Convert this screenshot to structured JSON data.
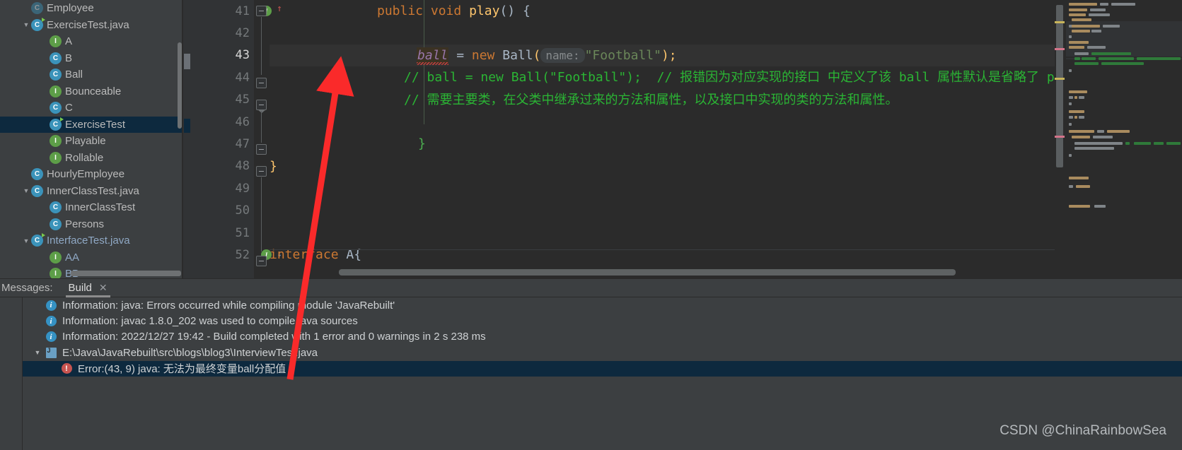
{
  "project_tree": {
    "items": [
      {
        "label": "Employee",
        "icon": "class-icon-faded",
        "indent": 1,
        "arrow": "",
        "kind": "class-faded",
        "selected": false
      },
      {
        "label": "ExerciseTest.java",
        "icon": "class-icon",
        "indent": 1,
        "arrow": "▼",
        "kind": "class-run",
        "selected": false
      },
      {
        "label": "A",
        "icon": "interface-icon",
        "indent": 2,
        "arrow": "",
        "kind": "iface",
        "selected": false
      },
      {
        "label": "B",
        "icon": "class-icon",
        "indent": 2,
        "arrow": "",
        "kind": "class",
        "selected": false
      },
      {
        "label": "Ball",
        "icon": "class-icon",
        "indent": 2,
        "arrow": "",
        "kind": "class",
        "selected": false
      },
      {
        "label": "Bounceable",
        "icon": "interface-icon",
        "indent": 2,
        "arrow": "",
        "kind": "iface",
        "selected": false
      },
      {
        "label": "C",
        "icon": "class-icon",
        "indent": 2,
        "arrow": "",
        "kind": "class",
        "selected": false
      },
      {
        "label": "ExerciseTest",
        "icon": "class-icon",
        "indent": 2,
        "arrow": "",
        "kind": "class-run",
        "selected": true
      },
      {
        "label": "Playable",
        "icon": "interface-icon",
        "indent": 2,
        "arrow": "",
        "kind": "iface",
        "selected": false
      },
      {
        "label": "Rollable",
        "icon": "interface-icon",
        "indent": 2,
        "arrow": "",
        "kind": "iface",
        "selected": false
      },
      {
        "label": "HourlyEmployee",
        "icon": "class-icon",
        "indent": 1,
        "arrow": "",
        "kind": "class",
        "selected": false
      },
      {
        "label": "InnerClassTest.java",
        "icon": "class-icon",
        "indent": 1,
        "arrow": "▼",
        "kind": "class",
        "selected": false
      },
      {
        "label": "InnerClassTest",
        "icon": "class-icon",
        "indent": 2,
        "arrow": "",
        "kind": "class",
        "selected": false
      },
      {
        "label": "Persons",
        "icon": "class-icon",
        "indent": 2,
        "arrow": "",
        "kind": "class",
        "selected": false
      },
      {
        "label": "InterfaceTest.java",
        "icon": "class-icon",
        "indent": 1,
        "arrow": "▼",
        "kind": "class-run-blue",
        "selected": false
      },
      {
        "label": "AA",
        "icon": "interface-icon",
        "indent": 2,
        "arrow": "",
        "kind": "iface-blue",
        "selected": false
      },
      {
        "label": "BB",
        "icon": "interface-icon",
        "indent": 2,
        "arrow": "",
        "kind": "iface-blue",
        "selected": false
      }
    ]
  },
  "editor": {
    "lines": [
      {
        "num": "41",
        "gutter_marks": [
          "interface-badge",
          "arrow-up-icon"
        ],
        "fold": "open"
      },
      {
        "num": "42",
        "gutter_marks": [],
        "fold": ""
      },
      {
        "num": "43",
        "gutter_marks": [],
        "fold": "",
        "current": true
      },
      {
        "num": "44",
        "gutter_marks": [],
        "fold": "open"
      },
      {
        "num": "45",
        "gutter_marks": [],
        "fold": "end"
      },
      {
        "num": "46",
        "gutter_marks": [],
        "fold": ""
      },
      {
        "num": "47",
        "gutter_marks": [],
        "fold": "open"
      },
      {
        "num": "48",
        "gutter_marks": [],
        "fold": "open"
      },
      {
        "num": "49",
        "gutter_marks": [],
        "fold": ""
      },
      {
        "num": "50",
        "gutter_marks": [],
        "fold": ""
      },
      {
        "num": "51",
        "gutter_marks": [],
        "fold": ""
      },
      {
        "num": "52",
        "gutter_marks": [
          "interface-badge",
          "arrow-down-icon"
        ],
        "fold": "open"
      }
    ],
    "code": {
      "l41_kw_public": "public",
      "l41_kw_void": "void",
      "l41_fn": "play",
      "l41_tail": "() {",
      "l43_var": "ball",
      "l43_eq": " = ",
      "l43_new": "new",
      "l43_cls": " Ball",
      "l43_paren_open": "(",
      "l43_hint": "name:",
      "l43_str": "\"Football\"",
      "l43_tail": ");",
      "l44_comment": "// ball = new Ball(\"Football\");",
      "l44_comment2": "// 报错因为对应实现的接口 中定义了该",
      "l44_code_ball": "ball",
      "l44_comment3": "属性默认是省略了",
      "l44_comment4": "public",
      "l45_comment": "// 需要主要类，在父类中继承过来的方法和属性，以及接口中实现的类的方法和属性。",
      "l47_brace": "}",
      "l48_brace": "}",
      "l52_kw": "interface",
      "l52_name": " A{"
    }
  },
  "messages_panel": {
    "title": "Messages:",
    "tab_label": "Build",
    "tab_close": "✕",
    "rows": [
      {
        "arrow": "",
        "icon": "info-icon",
        "indent": 0,
        "text": "Information: java: Errors occurred while compiling module 'JavaRebuilt'",
        "selected": false
      },
      {
        "arrow": "",
        "icon": "info-icon",
        "indent": 0,
        "text": "Information: javac 1.8.0_202 was used to compile java sources",
        "selected": false
      },
      {
        "arrow": "",
        "icon": "info-icon",
        "indent": 0,
        "text": "Information: 2022/12/27 19:42 - Build completed with 1 error and 0 warnings in 2 s 238 ms",
        "selected": false
      },
      {
        "arrow": "▼",
        "icon": "java-file-icon",
        "indent": 0,
        "text": "E:\\Java\\JavaRebuilt\\src\\blogs\\blog3\\InterviewTest.java",
        "selected": false
      },
      {
        "arrow": "",
        "icon": "error-icon",
        "indent": 1,
        "text": "Error:(43, 9)  java: 无法为最终变量ball分配值",
        "selected": true
      }
    ]
  },
  "left_tool_strip": {
    "buttons": [
      "run-arrows-icon",
      "grey-block-icon",
      "info-filter-icon",
      "warning-filter-icon",
      "wrench-icon"
    ]
  },
  "watermark": "CSDN @ChinaRainbowSea",
  "colors": {
    "editor_bg": "#2b2b2b",
    "panel_bg": "#3c3f41",
    "selection_blue": "#0d293e",
    "comment_green": "#2bb534",
    "keyword_orange": "#cc7832",
    "string_green": "#6a8759",
    "field_purple": "#9876aa",
    "method_yellow": "#ffc66d",
    "error_red": "#c75450",
    "info_blue": "#3592c4",
    "annotation_arrow": "#fa2a2a"
  }
}
